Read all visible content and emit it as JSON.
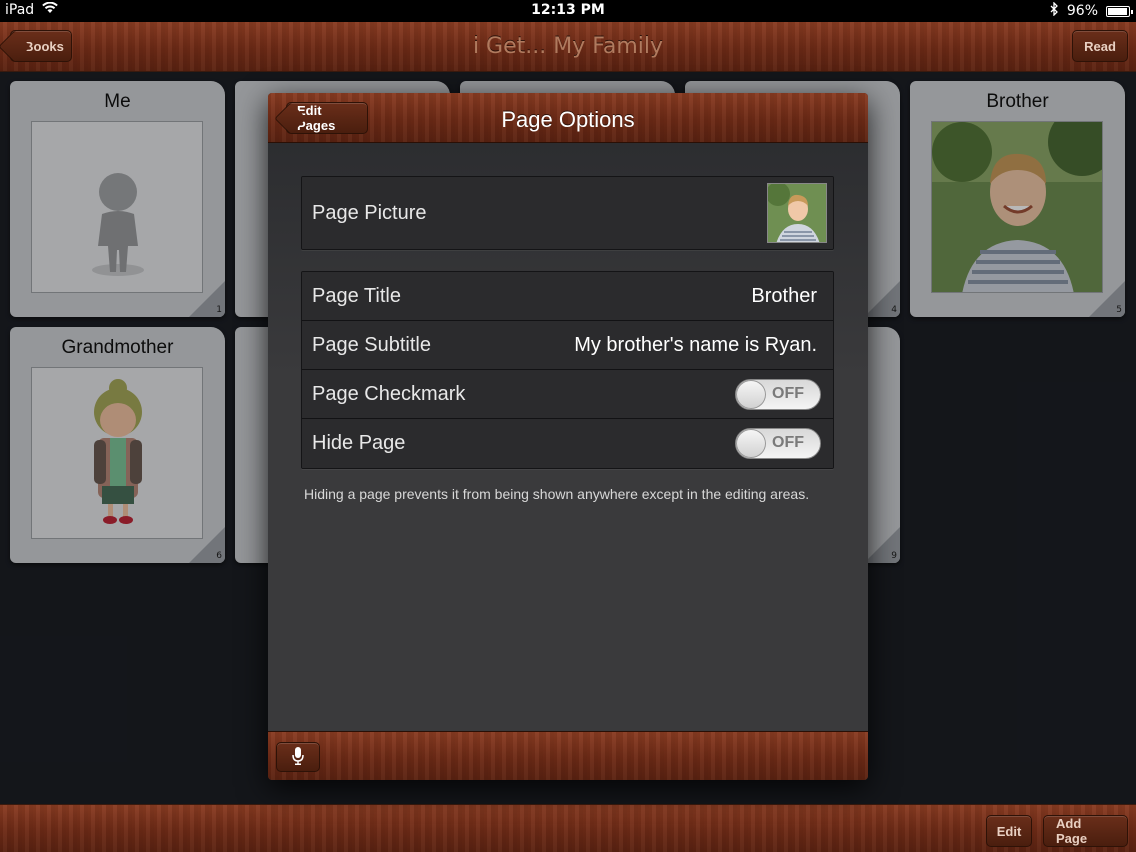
{
  "status_bar": {
    "device": "iPad",
    "time": "12:13 PM",
    "battery": "96%",
    "battery_level": 0.96
  },
  "nav": {
    "title": "i Get... My Family",
    "back_label": "Books",
    "read_label": "Read"
  },
  "cards": [
    {
      "title": "Me",
      "number": "1"
    },
    {
      "title": "Grandmother",
      "number": "6"
    },
    {
      "title": "Brother",
      "number": "5"
    },
    {
      "title": "",
      "number": "4"
    },
    {
      "title": "",
      "number": "9"
    }
  ],
  "bottom_bar": {
    "edit_label": "Edit",
    "add_page_label": "Add Page"
  },
  "modal": {
    "title": "Page Options",
    "back_label": "Edit Pages",
    "rows": {
      "picture": {
        "label": "Page Picture"
      },
      "title": {
        "label": "Page Title",
        "value": "Brother"
      },
      "subtitle": {
        "label": "Page Subtitle",
        "value": "My brother's name is Ryan."
      },
      "checkmark": {
        "label": "Page Checkmark",
        "toggle": "OFF"
      },
      "hide": {
        "label": "Hide Page",
        "toggle": "OFF"
      }
    },
    "footnote": "Hiding a page prevents it from being shown anywhere except in the editing areas."
  },
  "icons": [
    "wifi-icon",
    "bluetooth-icon",
    "battery-icon",
    "microphone-icon"
  ]
}
